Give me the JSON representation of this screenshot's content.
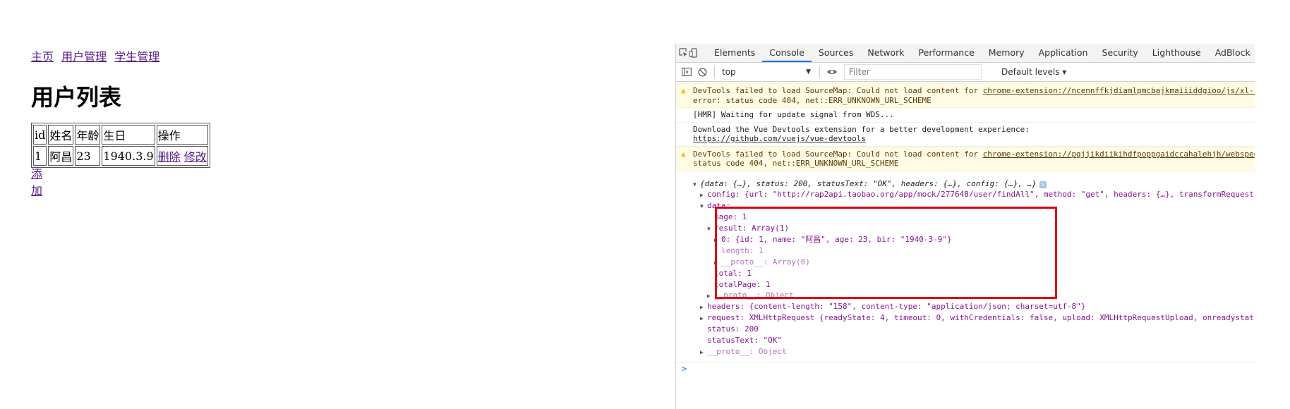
{
  "nav": {
    "links": [
      "主页",
      "用户管理",
      "学生管理"
    ]
  },
  "page_title": "用户列表",
  "table": {
    "headers": [
      "id",
      "姓名",
      "年龄",
      "生日",
      "操作"
    ],
    "rows": [
      {
        "id": "1",
        "name": "阿昌",
        "age": "23",
        "birthday": "1940.3.9",
        "delete": "删除",
        "edit": "修改"
      }
    ]
  },
  "add_link": "添加",
  "devtools": {
    "tabs": [
      "Elements",
      "Console",
      "Sources",
      "Network",
      "Performance",
      "Memory",
      "Application",
      "Security",
      "Lighthouse",
      "AdBlock"
    ],
    "active_tab": "Console",
    "context": "top",
    "filter_placeholder": "Filter",
    "levels": "Default levels ▾",
    "messages": {
      "warn1_text": "DevTools failed to load SourceMap: Could not load content for ",
      "warn1_link": "chrome-extension://ncennffkjdiamlpmcbajkmaiiiddgioo/js/xl-c",
      "warn1_line2": "error: status code 404, net::ERR_UNKNOWN_URL_SCHEME",
      "hmr": "[HMR] Waiting for update signal from WDS...",
      "vue_line1": "Download the Vue Devtools extension for a better development experience:",
      "vue_link": "https://github.com/vuejs/vue-devtools",
      "warn2_text": "DevTools failed to load SourceMap: Could not load content for ",
      "warn2_link": "chrome-extension://pgjjikdiikihdfpoppgaidccahalehjh/webspee",
      "warn2_line2": "status code 404, net::ERR_UNKNOWN_URL_SCHEME"
    },
    "object": {
      "summary": "{data: {…}, status: 200, statusText: \"OK\", headers: {…}, config: {…}, …}",
      "config_line": "config: {url: \"http://rap2api.taobao.org/app/mock/277648/user/findAll\", method: \"get\", headers: {…}, transformRequest",
      "data_key": "data:",
      "page": "page: 1",
      "result": "result: Array(1)",
      "item0": "0: {id: 1, name: \"阿昌\", age: 23, bir: \"1940-3-9\"}",
      "length": "length: 1",
      "proto_array": "__proto__: Array(0)",
      "total": "total: 1",
      "totalPage": "totalPage: 1",
      "proto_object_inner": "__proto__: Object",
      "headers_line": "headers: {content-length: \"158\", content-type: \"application/json; charset=utf-8\"}",
      "request_line": "request: XMLHttpRequest {readyState: 4, timeout: 0, withCredentials: false, upload: XMLHttpRequestUpload, onreadystat",
      "status": "status: 200",
      "statusText": "statusText: \"OK\"",
      "proto_object": "__proto__: Object"
    },
    "prompt": ">"
  },
  "colors": {
    "link": "#551a8b",
    "highlight": "#e0000e",
    "active_tab": "#1a73e8"
  }
}
